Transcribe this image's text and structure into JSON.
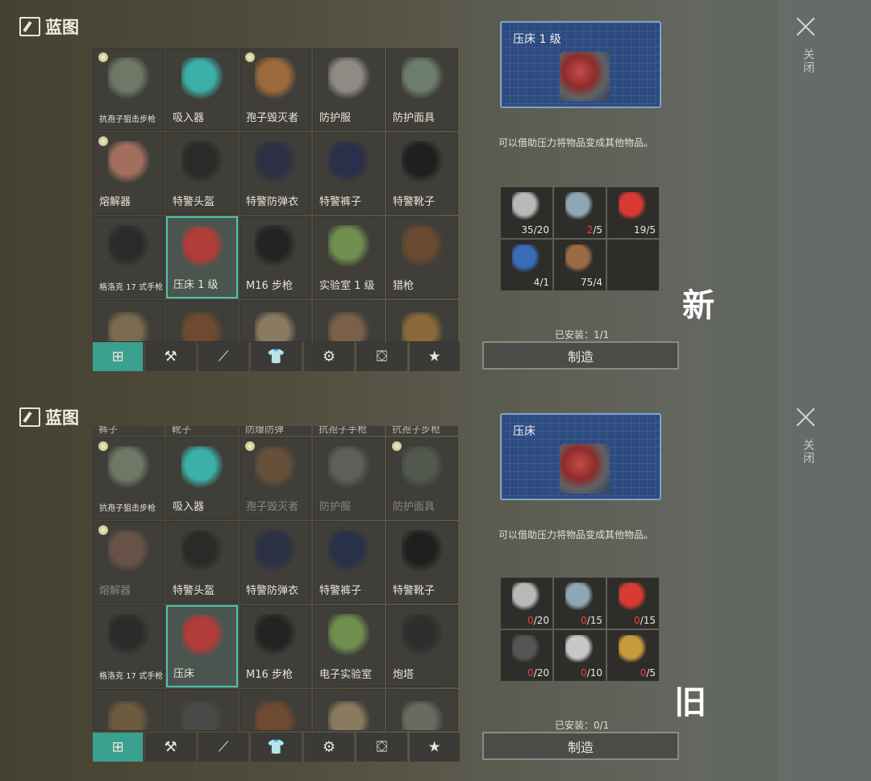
{
  "panels": [
    {
      "header": "蓝图",
      "close": "关闭",
      "tag": "新",
      "tiles": [
        {
          "label": "抗孢子狙击步枪",
          "small": true,
          "lamp": true,
          "color": "#6e7866",
          "dim": false
        },
        {
          "label": "吸入器",
          "color": "#3bb0a8",
          "dim": false
        },
        {
          "label": "孢子毁灭者",
          "lamp": true,
          "color": "#9c6a3a",
          "dim": false
        },
        {
          "label": "防护服",
          "color": "#8e8a84",
          "dim": false
        },
        {
          "label": "防护面具",
          "color": "#6d7d6b",
          "dim": false
        },
        {
          "label": "熔解器",
          "lamp": true,
          "color": "#a26f5e",
          "dim": false
        },
        {
          "label": "特警头盔",
          "color": "#2a2a28",
          "dim": false
        },
        {
          "label": "特警防弹衣",
          "color": "#2b3044",
          "dim": false
        },
        {
          "label": "特警裤子",
          "color": "#29304a",
          "dim": false
        },
        {
          "label": "特警靴子",
          "color": "#1f1f1f",
          "dim": false
        },
        {
          "label": "格洛克 17 式手枪",
          "small": true,
          "color": "#2b2b2b",
          "dim": false
        },
        {
          "label": "压床 1 级",
          "color": "#b23c38",
          "selected": true,
          "dim": false
        },
        {
          "label": "M16 步枪",
          "color": "#232323",
          "dim": false
        },
        {
          "label": "实验室 1 级",
          "color": "#6f8f4e",
          "dim": false
        },
        {
          "label": "猎枪",
          "color": "#6a4a30",
          "dim": false
        },
        {
          "label": "",
          "short": true,
          "color": "#7a6a50",
          "dim": false
        },
        {
          "label": "",
          "short": true,
          "color": "#6e4a30",
          "dim": false
        },
        {
          "label": "",
          "short": true,
          "color": "#8a7a60",
          "dim": false
        },
        {
          "label": "",
          "short": true,
          "color": "#7a6048",
          "dim": false
        },
        {
          "label": "",
          "short": true,
          "color": "#8a6a38",
          "dim": false
        }
      ],
      "tabs": [
        "⊞",
        "⚒",
        "⟋",
        "👕",
        "⚙",
        "⛋",
        "★"
      ],
      "detail": {
        "name": "压床 1 级",
        "description": "可以借助压力将物品变成其他物品。",
        "materials": [
          {
            "name": "bearing-icon",
            "color": "#b8b8b8",
            "have": "35",
            "need": "/20",
            "short": false
          },
          {
            "name": "metal-plate-icon",
            "color": "#8fa6b4",
            "have": "2",
            "need": "/5",
            "short": true
          },
          {
            "name": "oil-can-icon",
            "color": "#d63a33",
            "have": "19",
            "need": "/5",
            "short": false
          },
          {
            "name": "battery-icon",
            "color": "#3a6bb8",
            "have": "4",
            "need": "/1",
            "short": false
          },
          {
            "name": "wood-plank-icon",
            "color": "#9b6b44",
            "have": "75",
            "need": "/4",
            "short": false
          }
        ],
        "installed": "已安装：1/1",
        "craft": "制造"
      }
    },
    {
      "header": "蓝图",
      "close": "关闭",
      "tag": "旧",
      "topStrip": [
        "裤子",
        "靴子",
        "防爆防弹",
        "抗孢子手枪",
        "抗孢子步枪"
      ],
      "tiles": [
        {
          "label": "抗孢子狙击步枪",
          "small": true,
          "lamp": true,
          "color": "#6e7866",
          "dim": false
        },
        {
          "label": "吸入器",
          "color": "#3bb0a8",
          "dim": false
        },
        {
          "label": "孢子毁灭者",
          "lamp": true,
          "color": "#9c6a3a",
          "dim": true
        },
        {
          "label": "防护服",
          "color": "#8e8a84",
          "dim": true
        },
        {
          "label": "防护面具",
          "lamp": true,
          "color": "#6d7d6b",
          "dim": true
        },
        {
          "label": "熔解器",
          "lamp": true,
          "color": "#a26f5e",
          "dim": true
        },
        {
          "label": "特警头盔",
          "color": "#2a2a28",
          "dim": false
        },
        {
          "label": "特警防弹衣",
          "color": "#2b3044",
          "dim": false
        },
        {
          "label": "特警裤子",
          "color": "#29304a",
          "dim": false
        },
        {
          "label": "特警靴子",
          "color": "#1f1f1f",
          "dim": false
        },
        {
          "label": "格洛克 17 式手枪",
          "small": true,
          "color": "#2b2b2b",
          "dim": false
        },
        {
          "label": "压床",
          "color": "#b23c38",
          "selected": true,
          "dim": false
        },
        {
          "label": "M16 步枪",
          "color": "#232323",
          "dim": false
        },
        {
          "label": "电子实验室",
          "color": "#6f8f4e",
          "dim": false
        },
        {
          "label": "炮塔",
          "color": "#2e2e2e",
          "dim": false
        },
        {
          "label": "",
          "short": true,
          "color": "#6e5a40",
          "dim": false
        },
        {
          "label": "",
          "short": true,
          "color": "#4a4a4a",
          "dim": false
        },
        {
          "label": "",
          "short": true,
          "color": "#6e4a30",
          "dim": false
        },
        {
          "label": "",
          "short": true,
          "color": "#8a7a60",
          "dim": false
        },
        {
          "label": "",
          "short": true,
          "color": "#6a6a60",
          "dim": false
        }
      ],
      "tabs": [
        "⊞",
        "⚒",
        "⟋",
        "👕",
        "⚙",
        "⛋",
        "★"
      ],
      "detail": {
        "name": "压床",
        "description": "可以借助压力将物品变成其他物品。",
        "materials": [
          {
            "name": "bearing-icon",
            "color": "#b8b8b8",
            "have": "0",
            "need": "/20",
            "short": true
          },
          {
            "name": "metal-plate-icon",
            "color": "#8fa6b4",
            "have": "0",
            "need": "/15",
            "short": true
          },
          {
            "name": "oil-can-icon",
            "color": "#d63a33",
            "have": "0",
            "need": "/15",
            "short": true
          },
          {
            "name": "spring-icon",
            "color": "#555555",
            "have": "0",
            "need": "/20",
            "short": true
          },
          {
            "name": "wrench-icon",
            "color": "#c8c8c8",
            "have": "0",
            "need": "/10",
            "short": true
          },
          {
            "name": "hammer-icon",
            "color": "#c79a3b",
            "have": "0",
            "need": "/5",
            "short": true
          }
        ],
        "installed": "已安装：0/1",
        "craft": "制造"
      }
    }
  ]
}
